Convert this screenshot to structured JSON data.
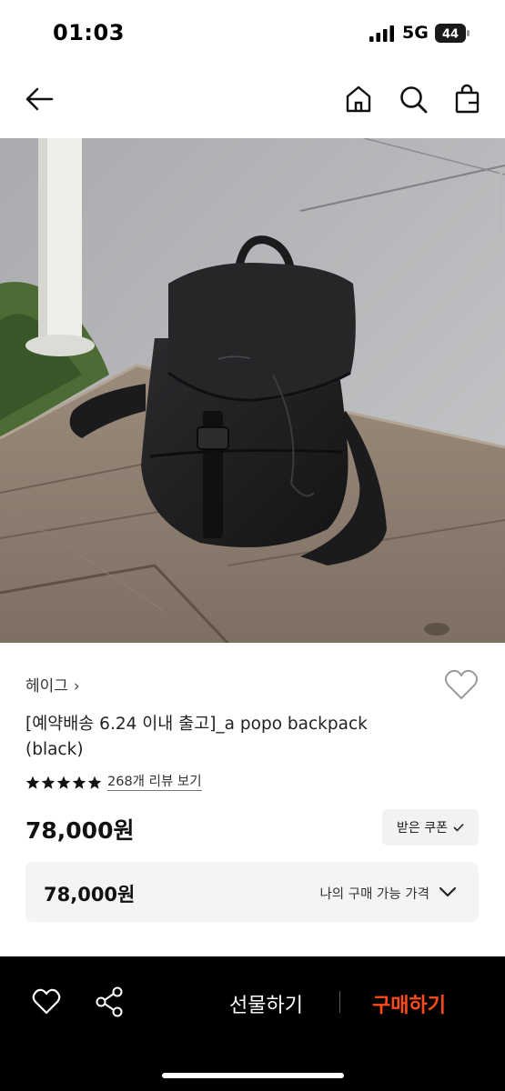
{
  "status_bar": {
    "time": "01:03",
    "network": "5G",
    "battery": "44"
  },
  "nav": {
    "back_icon": "arrow-left-icon",
    "home_icon": "home-icon",
    "search_icon": "search-icon",
    "bag_icon": "shopping-bag-icon"
  },
  "product": {
    "brand": "헤이그",
    "brand_chevron": "›",
    "title": "[예약배송 6.24 이내 출고]_a popo backpack (black)",
    "rating_stars": 5,
    "review_link": "268개 리뷰 보기",
    "price": "78,000원",
    "coupon_button": "받은 쿠폰",
    "best_price": "78,000원",
    "best_price_label": "나의 구매 가능 가격"
  },
  "bottom_bar": {
    "gift_label": "선물하기",
    "buy_label": "구매하기",
    "heart_icon": "heart-outline-icon",
    "share_icon": "share-icon"
  },
  "colors": {
    "buy_accent": "#ff4a1c",
    "bottom_bar_bg": "#000000",
    "box_bg": "#f4f4f6"
  }
}
